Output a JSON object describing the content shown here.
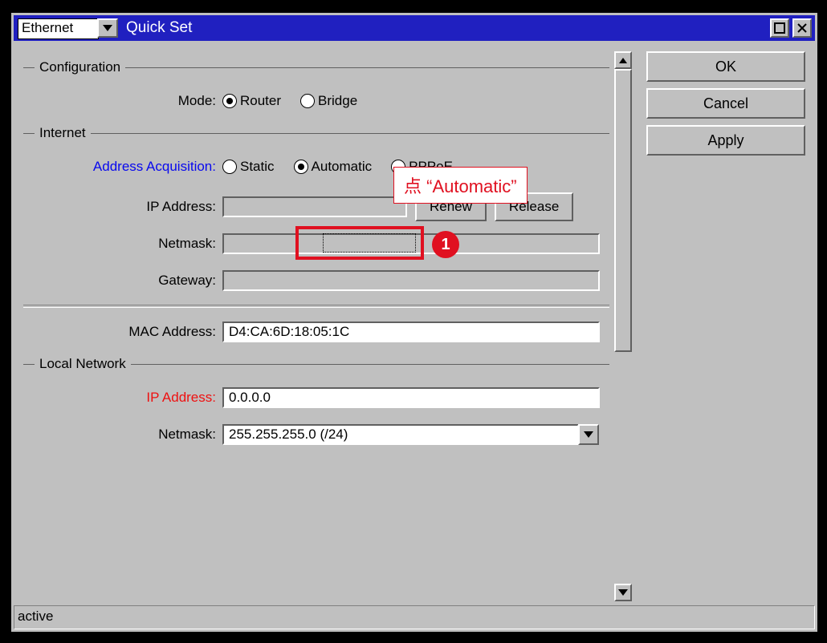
{
  "titlebar": {
    "dropdown": "Ethernet",
    "title": "Quick Set"
  },
  "buttons": {
    "ok": "OK",
    "cancel": "Cancel",
    "apply": "Apply",
    "renew": "Renew",
    "release": "Release"
  },
  "sections": {
    "configuration": {
      "title": "Configuration",
      "mode_label": "Mode:",
      "router": "Router",
      "bridge": "Bridge"
    },
    "internet": {
      "title": "Internet",
      "addr_acq_label": "Address Acquisition:",
      "static": "Static",
      "automatic": "Automatic",
      "pppoe": "PPPoE",
      "ip_label": "IP Address:",
      "ip_value": "",
      "netmask_label": "Netmask:",
      "netmask_value": "",
      "gateway_label": "Gateway:",
      "gateway_value": "",
      "mac_label": "MAC Address:",
      "mac_value": "D4:CA:6D:18:05:1C"
    },
    "local": {
      "title": "Local Network",
      "ip_label": "IP Address:",
      "ip_value": "0.0.0.0",
      "netmask_label": "Netmask:",
      "netmask_value": "255.255.255.0 (/24)"
    }
  },
  "status": "active",
  "annotation": {
    "callout": "点 “Automatic”",
    "badge": "1"
  }
}
